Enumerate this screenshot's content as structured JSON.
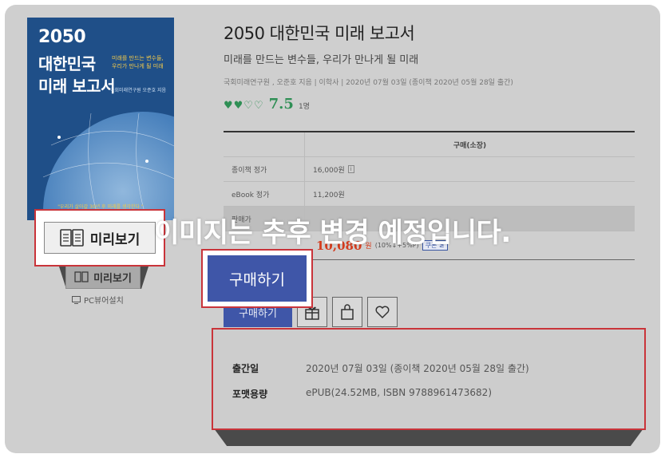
{
  "book": {
    "cover": {
      "year": "2050",
      "line1": "대한민국",
      "line2": "미래 보고서",
      "subtitle": "미래를 만드는 변수들, 우리가 만나게 될 미래",
      "author": "국회미래연구원 오준호 지음",
      "quote": "\"우리가 살아갈 30년 후 미래를 생각한다.\""
    },
    "title": "2050 대한민국 미래 보고서",
    "subtitle": "미래를 만드는 변수들, 우리가 만나게 될 미래",
    "meta": "국회미래연구원 , 오준호 지음  |  이학사  |  2020년 07월 03일 (종이책 2020년 05월 28일 출간)",
    "rating": {
      "hearts": "♥♥♡♡",
      "score": "7.5",
      "count": "1명"
    }
  },
  "price_table": {
    "header": "구매(소장)",
    "rows": [
      {
        "label": "종이책 정가",
        "value": "16,000원",
        "badge": "i"
      },
      {
        "label": "eBook 정가",
        "value": "11,200원"
      },
      {
        "label": "판매가",
        "value": ""
      }
    ],
    "final": {
      "price": "10,080",
      "unit": "원",
      "discount": "(10%↓+5%P)",
      "coupon": "쿠폰 ≥"
    }
  },
  "preview": {
    "label": "미리보기",
    "pc_viewer": "PC뷰어설치"
  },
  "buy": {
    "label": "구매하기"
  },
  "info": {
    "pub_date_label": "출간일",
    "pub_date_value": "2020년 07월 03일 (종이책 2020년 05월 28일 출간)",
    "format_label": "포맷용량",
    "format_value": "ePUB(24.52MB, ISBN 9788961473682)"
  },
  "notice": "이미지는 추후 변경 예정입니다.",
  "colors": {
    "accent_blue": "#3f56a8",
    "highlight_red": "#c9343a",
    "rating_green": "#2f8f55",
    "price_red": "#d43c1e"
  }
}
